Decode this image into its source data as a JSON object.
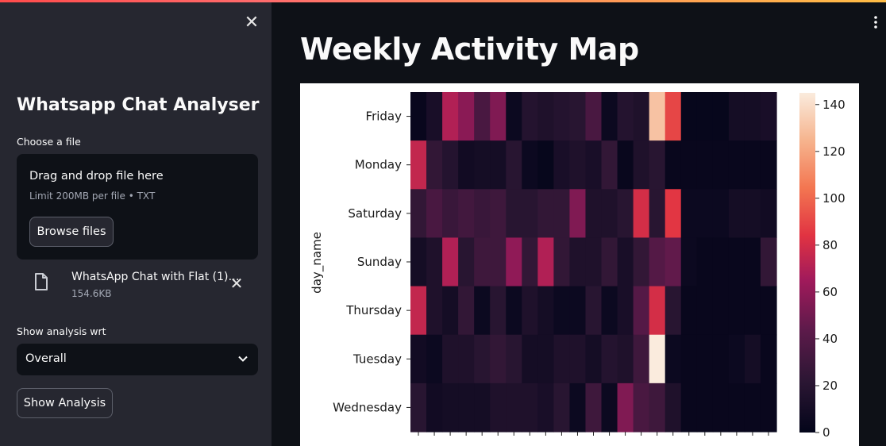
{
  "sidebar": {
    "close_icon": "close-icon",
    "title": "Whatsapp Chat Analyser",
    "uploader": {
      "label": "Choose a file",
      "drop_title": "Drag and drop file here",
      "drop_sub": "Limit 200MB per file • TXT",
      "browse_label": "Browse files"
    },
    "file": {
      "name": "WhatsApp Chat with Flat (1)…",
      "size": "154.6KB"
    },
    "analysis": {
      "label": "Show analysis wrt",
      "selected": "Overall",
      "button_label": "Show Analysis"
    }
  },
  "main": {
    "title": "Weekly Activity Map",
    "menu_icon": "kebab-menu-icon"
  },
  "colors": {
    "sidebar_bg": "#262730",
    "main_bg": "#0e1117",
    "accent": "#ff4b4b"
  },
  "chart_data": {
    "type": "heatmap",
    "title": "",
    "ylabel": "day_name",
    "xlabel": "",
    "rows": [
      "Friday",
      "Monday",
      "Saturday",
      "Sunday",
      "Thursday",
      "Tuesday",
      "Wednesday"
    ],
    "columns": 23,
    "values": [
      [
        3,
        12,
        70,
        58,
        35,
        55,
        5,
        18,
        15,
        18,
        20,
        35,
        5,
        18,
        15,
        130,
        90,
        2,
        2,
        2,
        10,
        10,
        12
      ],
      [
        75,
        25,
        18,
        8,
        10,
        10,
        20,
        5,
        2,
        12,
        15,
        12,
        25,
        3,
        15,
        20,
        3,
        3,
        3,
        3,
        3,
        3,
        3
      ],
      [
        25,
        35,
        28,
        32,
        28,
        30,
        20,
        20,
        25,
        25,
        55,
        15,
        15,
        20,
        80,
        20,
        85,
        5,
        5,
        5,
        10,
        10,
        8
      ],
      [
        10,
        15,
        70,
        20,
        30,
        30,
        60,
        25,
        70,
        25,
        15,
        15,
        25,
        12,
        25,
        40,
        45,
        5,
        3,
        3,
        3,
        3,
        25
      ],
      [
        75,
        15,
        10,
        25,
        5,
        20,
        5,
        15,
        10,
        5,
        5,
        20,
        5,
        12,
        40,
        80,
        20,
        3,
        3,
        3,
        3,
        3,
        3
      ],
      [
        8,
        5,
        15,
        15,
        20,
        25,
        20,
        10,
        10,
        15,
        15,
        10,
        18,
        15,
        30,
        145,
        5,
        3,
        3,
        3,
        5,
        10,
        3
      ],
      [
        20,
        8,
        10,
        10,
        10,
        15,
        15,
        15,
        12,
        20,
        5,
        30,
        5,
        55,
        35,
        30,
        15,
        3,
        3,
        3,
        3,
        3,
        3
      ]
    ],
    "colorbar_ticks": [
      0,
      20,
      40,
      60,
      80,
      100,
      120,
      140
    ],
    "colorbar_range": [
      0,
      145
    ],
    "colormap": "rocket"
  }
}
